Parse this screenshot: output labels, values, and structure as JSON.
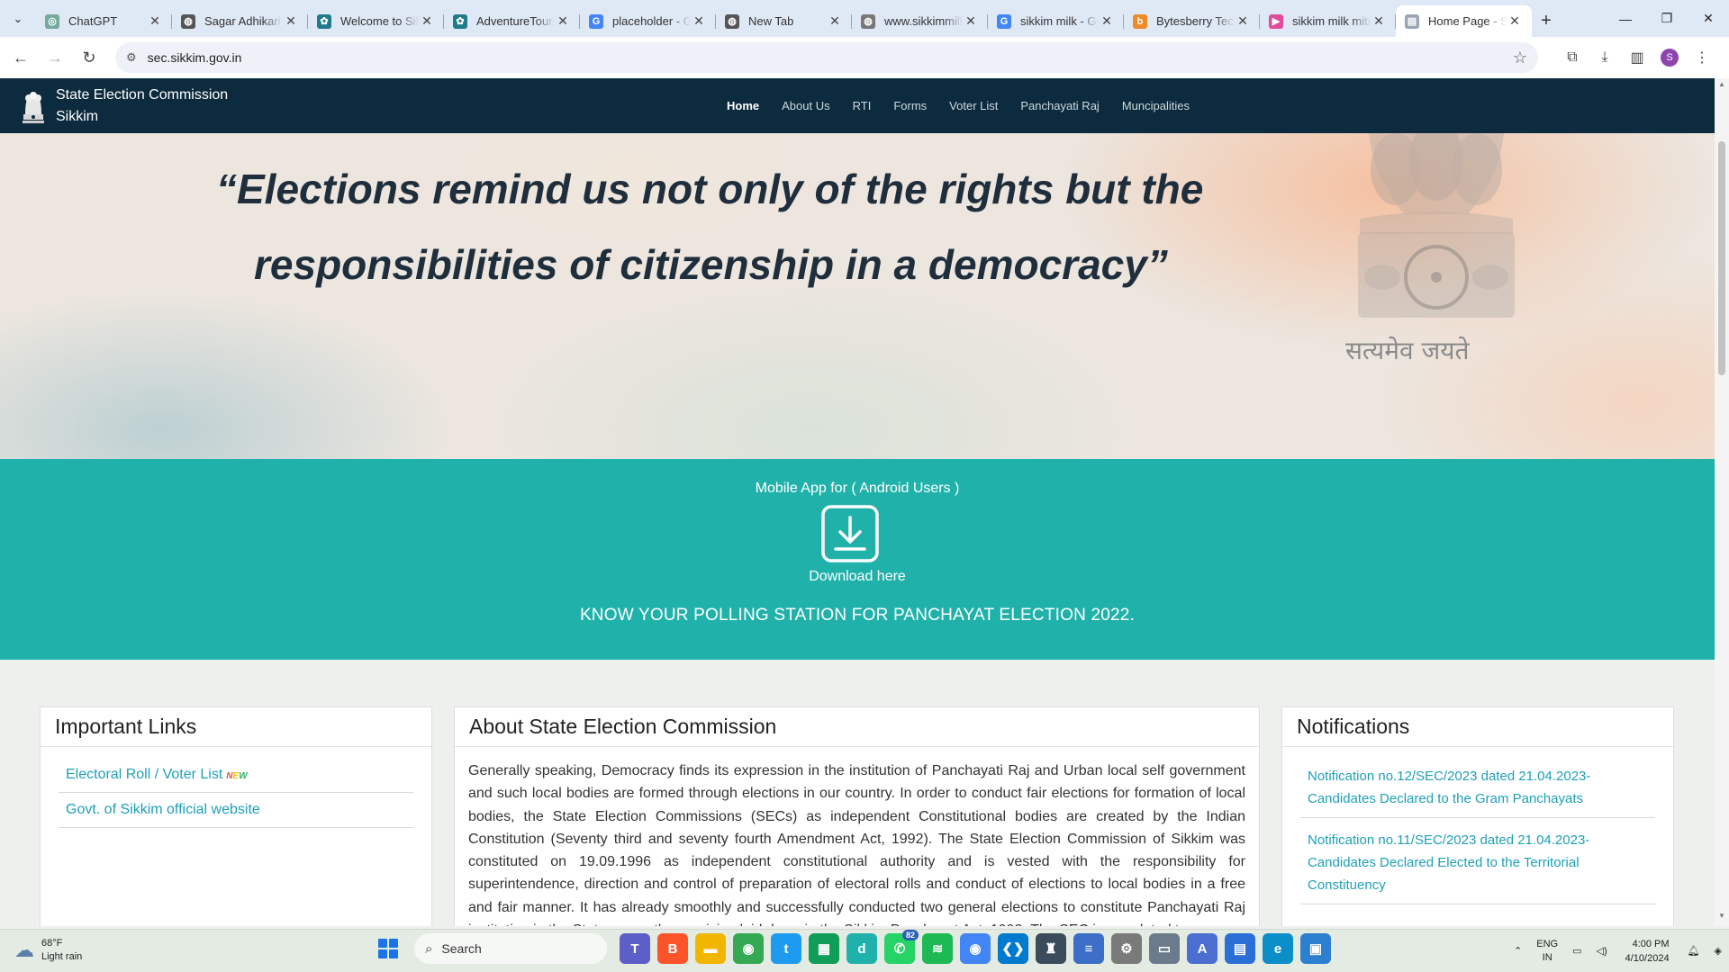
{
  "browser": {
    "tabs": [
      {
        "title": "ChatGPT",
        "favicon_color": "#74aa9c",
        "favicon_glyph": "◎",
        "active": false
      },
      {
        "title": "Sagar Adhikari",
        "favicon_color": "#555555",
        "favicon_glyph": "◍",
        "active": false
      },
      {
        "title": "Welcome to Sikkim",
        "favicon_color": "#1f7a8c",
        "favicon_glyph": "✿",
        "active": false
      },
      {
        "title": "AdventureTours",
        "favicon_color": "#1f7a8c",
        "favicon_glyph": "✿",
        "active": false
      },
      {
        "title": "placeholder - Google",
        "favicon_color": "#4285f4",
        "favicon_glyph": "G",
        "active": false
      },
      {
        "title": "New Tab",
        "favicon_color": "#555555",
        "favicon_glyph": "◍",
        "active": false
      },
      {
        "title": "www.sikkimmilk",
        "favicon_color": "#777777",
        "favicon_glyph": "◍",
        "active": false
      },
      {
        "title": "sikkim milk - Google",
        "favicon_color": "#4285f4",
        "favicon_glyph": "G",
        "active": false
      },
      {
        "title": "Bytesberry Tech",
        "favicon_color": "#f08a24",
        "favicon_glyph": "b",
        "active": false
      },
      {
        "title": "sikkim milk mitra",
        "favicon_color": "#e24a9a",
        "favicon_glyph": "▶",
        "active": false
      },
      {
        "title": "Home Page - SEC",
        "favicon_color": "#9aa6b5",
        "favicon_glyph": "▤",
        "active": true
      }
    ],
    "url": "sec.sikkim.gov.in",
    "profile_initial": "S"
  },
  "site": {
    "brand_line1": "State Election Commission",
    "brand_line2": "Sikkim",
    "menu": [
      {
        "label": "Home",
        "active": true
      },
      {
        "label": "About Us",
        "active": false
      },
      {
        "label": "RTI",
        "active": false
      },
      {
        "label": "Forms",
        "active": false
      },
      {
        "label": "Voter List",
        "active": false
      },
      {
        "label": "Panchayati Raj",
        "active": false
      },
      {
        "label": "Muncipalities",
        "active": false
      }
    ],
    "hero": {
      "quote_line1": "“Elections remind us not only of the rights but the",
      "quote_line2": "responsibilities of citizenship in a democracy”",
      "motto": "सत्यमेव जयते"
    },
    "app_band": {
      "title": "Mobile App for ( Android Users )",
      "download_label": "Download here",
      "polling_text": "KNOW YOUR POLLING STATION FOR PANCHAYAT ELECTION 2022."
    },
    "important_links": {
      "heading": "Important Links",
      "items": [
        {
          "label": "Electoral Roll / Voter List",
          "badge": "NEW"
        },
        {
          "label": "Govt. of Sikkim official website",
          "badge": ""
        }
      ]
    },
    "about": {
      "heading": "About State Election Commission",
      "body": "Generally speaking, Democracy finds its expression in the institution of Panchayati Raj and Urban local self government and such local bodies are formed through elections in our country. In order to conduct fair elections for formation of local bodies, the State Election Commissions (SECs) as independent Constitutional bodies are created by the Indian Constitution (Seventy third and seventy fourth Amendment Act, 1992). The State Election Commission of Sikkim was constituted on 19.09.1996 as independent constitutional authority and is vested with the responsibility for superintendence, direction and control of preparation of electoral rolls and conduct of elections to local bodies in a free and fair manner. It has already smoothly and successfully conducted two general elections to constitute Panchayati Raj institution in the State as per the provision laid down in the Sikkim Panchayat Act, 1993. The SEC is mandated to"
    },
    "notifications": {
      "heading": "Notifications",
      "items": [
        "Notification no.12/SEC/2023 dated 21.04.2023-Candidates Declared to the Gram Panchayats",
        "Notification no.11/SEC/2023 dated 21.04.2023-Candidates Declared Elected to the Territorial Constituency"
      ]
    }
  },
  "taskbar": {
    "weather_temp": "68°F",
    "weather_desc": "Light rain",
    "search_placeholder": "Search",
    "apps": [
      {
        "name": "teams",
        "color": "#5b5fc7",
        "glyph": "T"
      },
      {
        "name": "brave",
        "color": "#fb542b",
        "glyph": "B"
      },
      {
        "name": "file-explorer",
        "color": "#f2b600",
        "glyph": "▬"
      },
      {
        "name": "chrome",
        "color": "#34a853",
        "glyph": "◉"
      },
      {
        "name": "twitter",
        "color": "#1d9bf0",
        "glyph": "t"
      },
      {
        "name": "sheets",
        "color": "#0f9d58",
        "glyph": "▦"
      },
      {
        "name": "app-d",
        "color": "#20b2aa",
        "glyph": "d"
      },
      {
        "name": "whatsapp",
        "color": "#25d366",
        "glyph": "✆",
        "badge": "82"
      },
      {
        "name": "spotify",
        "color": "#1db954",
        "glyph": "≋"
      },
      {
        "name": "chrome-profile",
        "color": "#4285f4",
        "glyph": "◉"
      },
      {
        "name": "vscode",
        "color": "#007acc",
        "glyph": "❮❯"
      },
      {
        "name": "app-horn",
        "color": "#3a4b5c",
        "glyph": "♜"
      },
      {
        "name": "notepad",
        "color": "#3c6ec7",
        "glyph": "≡"
      },
      {
        "name": "settings",
        "color": "#7a7a7a",
        "glyph": "⚙"
      },
      {
        "name": "window-app",
        "color": "#6b7b8c",
        "glyph": "▭"
      },
      {
        "name": "font-app",
        "color": "#4a6fd1",
        "glyph": "A"
      },
      {
        "name": "doc-app",
        "color": "#2b6fd6",
        "glyph": "▤"
      },
      {
        "name": "edge",
        "color": "#0c8ec8",
        "glyph": "e"
      },
      {
        "name": "photos",
        "color": "#2d7fd0",
        "glyph": "▣"
      }
    ],
    "lang": "ENG",
    "region": "IN",
    "time": "4:00 PM",
    "date": "4/10/2024"
  }
}
